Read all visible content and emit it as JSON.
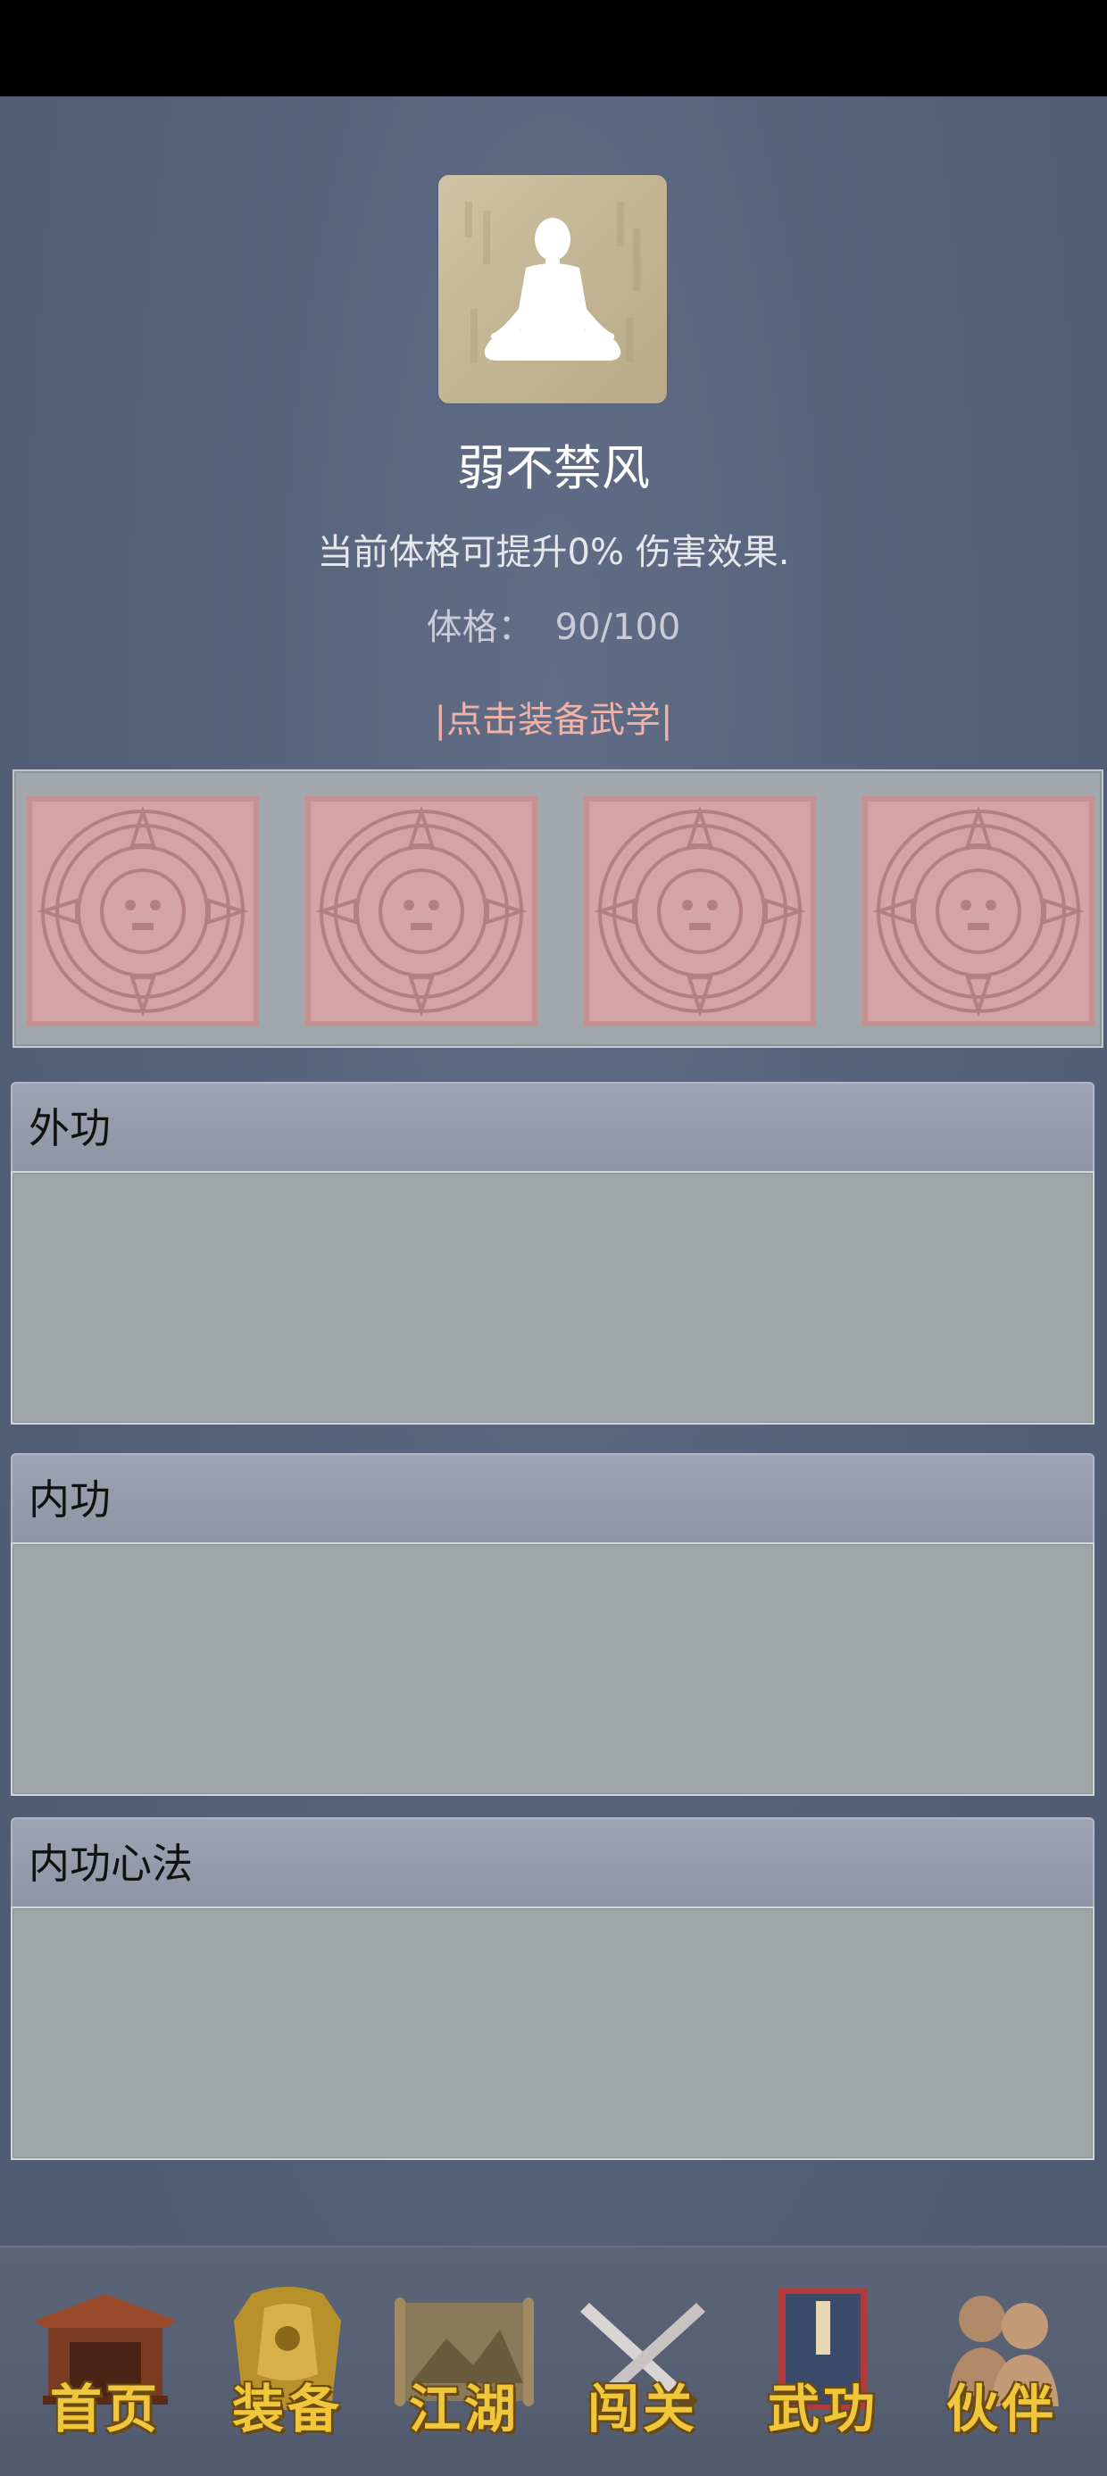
{
  "header": {
    "title": "弱不禁风",
    "description": "当前体格可提升0% 伤害效果.",
    "stat_label": "体格：",
    "stat_value": "90/100",
    "equip_link": "|点击装备武学|"
  },
  "avatar": {
    "icon": "meditation-silhouette-icon"
  },
  "slots": [
    {
      "icon": "aztec-calendar-seal-icon"
    },
    {
      "icon": "aztec-calendar-seal-icon"
    },
    {
      "icon": "aztec-calendar-seal-icon"
    },
    {
      "icon": "aztec-calendar-seal-icon"
    }
  ],
  "sections": [
    {
      "label": "外功"
    },
    {
      "label": "内功"
    },
    {
      "label": "内功心法"
    }
  ],
  "nav": [
    {
      "label": "首页",
      "icon": "temple-gate-icon"
    },
    {
      "label": "装备",
      "icon": "armor-icon"
    },
    {
      "label": "江湖",
      "icon": "map-scroll-icon"
    },
    {
      "label": "闯关",
      "icon": "crossed-swords-icon"
    },
    {
      "label": "武功",
      "icon": "martial-book-icon"
    },
    {
      "label": "伙伴",
      "icon": "companions-icon"
    }
  ],
  "colors": {
    "background": "#56627a",
    "title": "#ffffff",
    "equip_link": "#f0b2a8",
    "nav_label": "#f0c63a"
  }
}
